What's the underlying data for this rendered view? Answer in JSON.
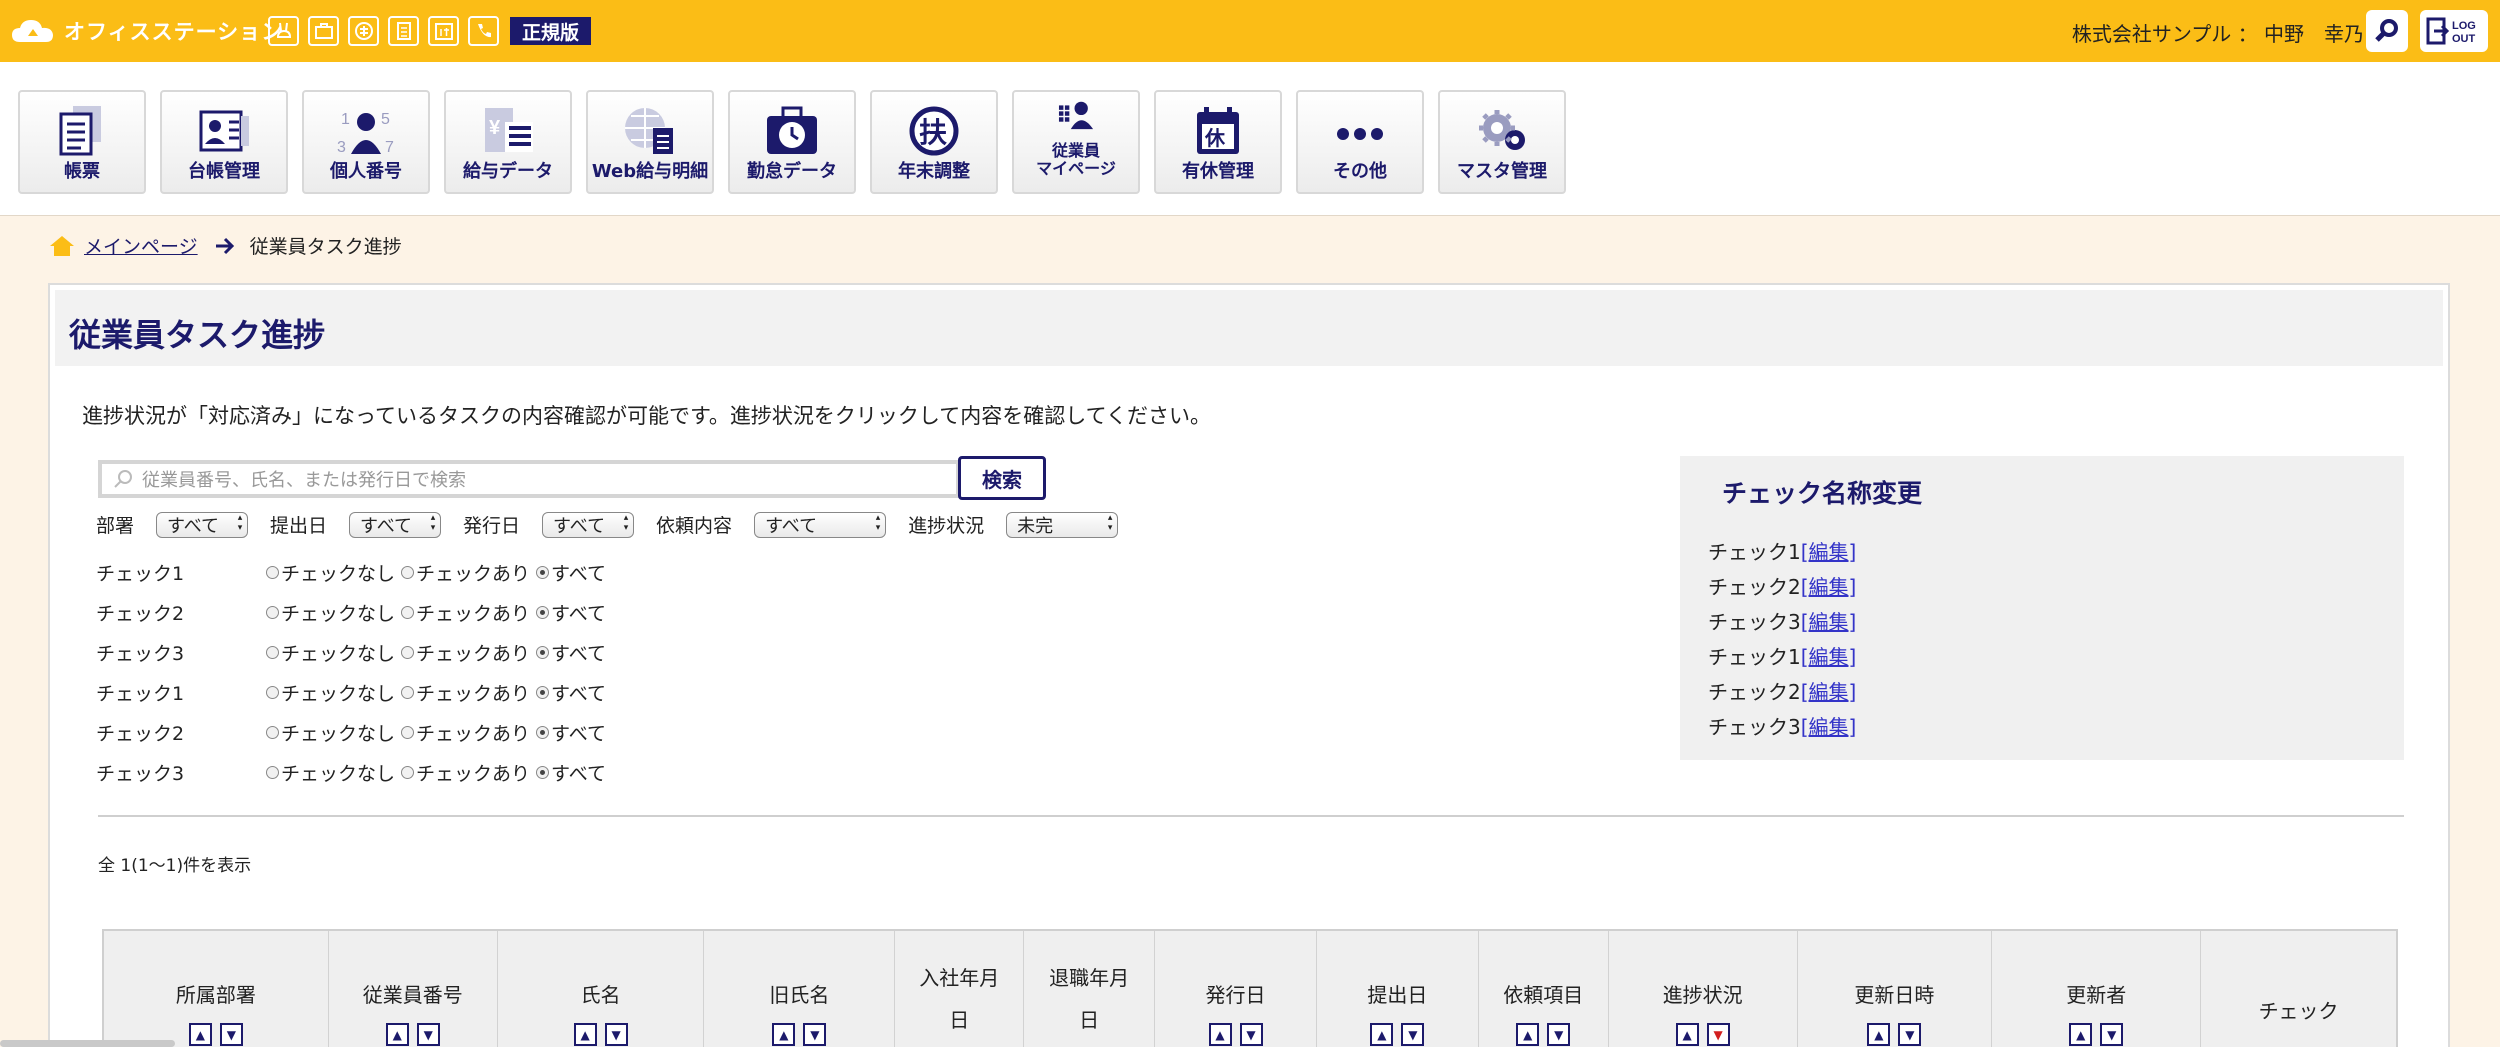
{
  "app": {
    "name": "オフィスステーション",
    "edition": "正規版",
    "user": "株式会社サンプル ： 中野　幸乃"
  },
  "top_icons": [
    "rabbit-icon",
    "briefcase-icon",
    "fu-icon",
    "document-icon",
    "yasumi-icon",
    "phone-icon"
  ],
  "nav": [
    {
      "label": "帳票",
      "icon": "document-list-icon"
    },
    {
      "label": "台帳管理",
      "icon": "ledger-icon"
    },
    {
      "label": "個人番号",
      "icon": "my-number-icon"
    },
    {
      "label": "給与データ",
      "icon": "salary-icon"
    },
    {
      "label": "Web給与明細",
      "icon": "web-payslip-icon"
    },
    {
      "label": "勤怠データ",
      "icon": "attendance-icon"
    },
    {
      "label": "年末調整",
      "icon": "year-end-icon"
    },
    {
      "label_l1": "従業員",
      "label_l2": "マイページ",
      "icon": "employee-mypage-icon"
    },
    {
      "label": "有休管理",
      "icon": "paid-leave-icon"
    },
    {
      "label": "その他",
      "icon": "more-icon"
    },
    {
      "label": "マスタ管理",
      "icon": "master-settings-icon"
    }
  ],
  "breadcrumb": {
    "home": "メインページ",
    "current": "従業員タスク進捗"
  },
  "page": {
    "title": "従業員タスク進捗",
    "description": "進捗状況が「対応済み」になっているタスクの内容確認が可能です。進捗状況をクリックして内容を確認してください。"
  },
  "search": {
    "placeholder": "従業員番号、氏名、または発行日で検索",
    "button": "検索"
  },
  "filters": [
    {
      "label": "部署",
      "value": "すべて"
    },
    {
      "label": "提出日",
      "value": "すべて"
    },
    {
      "label": "発行日",
      "value": "すべて"
    },
    {
      "label": "依頼内容",
      "value": "すべて"
    },
    {
      "label": "進捗状況",
      "value": "未完"
    }
  ],
  "radio_options": [
    "チェックなし",
    "チェックあり",
    "すべて"
  ],
  "checks": [
    "チェック1",
    "チェック2",
    "チェック3",
    "チェック1",
    "チェック2",
    "チェック3"
  ],
  "rename": {
    "title": "チェック名称変更",
    "edit": "[編集]",
    "items": [
      "チェック1",
      "チェック2",
      "チェック3",
      "チェック1",
      "チェック2",
      "チェック3"
    ]
  },
  "count_text": "全 1(1〜1)件を表示",
  "table": {
    "headers": [
      "所属部署",
      "従業員番号",
      "氏名",
      "旧氏名",
      "入社年月日",
      "退職年月日",
      "発行日",
      "提出日",
      "依頼項目",
      "進捗状況",
      "更新日時",
      "更新者",
      "チェック"
    ],
    "header_two_line": {
      "4": [
        "入社年月",
        "日"
      ],
      "5": [
        "退職年月",
        "日"
      ]
    },
    "active_sort": "進捗状況"
  },
  "colors": {
    "brand_yellow": "#fbbd16",
    "brand_navy": "#1c1a6b",
    "background": "#fdf3e6"
  }
}
